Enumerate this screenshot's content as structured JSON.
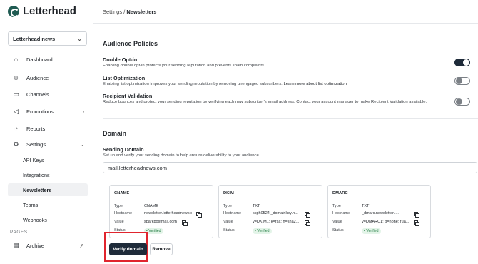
{
  "brand": {
    "name": "Letterhead",
    "color": "#1f5b52"
  },
  "publication_select": {
    "value": "Letterhead news"
  },
  "breadcrumb": {
    "parent": "Settings",
    "separator": " / ",
    "current": "Newsletters"
  },
  "sidebar": {
    "items": [
      {
        "label": "Dashboard",
        "icon": "home-icon"
      },
      {
        "label": "Audience",
        "icon": "users-icon"
      },
      {
        "label": "Channels",
        "icon": "monitor-icon"
      },
      {
        "label": "Promotions",
        "icon": "megaphone-icon"
      },
      {
        "label": "Reports",
        "icon": "chart-icon"
      },
      {
        "label": "Settings",
        "icon": "gear-icon"
      }
    ],
    "settings_sub": [
      "API Keys",
      "Integrations",
      "Newsletters",
      "Teams",
      "Webhooks"
    ],
    "pages_label": "PAGES",
    "archive": {
      "label": "Archive",
      "icon": "archive-icon"
    }
  },
  "audience_policies": {
    "heading": "Audience Policies",
    "policies": [
      {
        "title": "Double Opt-in",
        "desc": "Enabling double opt-in protects your sending reputation and prevents spam complaints.",
        "enabled": true
      },
      {
        "title": "List Optimization",
        "desc": "Enabling list optimization improves your sending reputation by removing unengaged subscribers.",
        "link": "Learn more about list optimization.",
        "enabled": false
      },
      {
        "title": "Recipient Validation",
        "desc": "Reduce bounces and protect your sending reputation by verifying each new subscriber's email address. Contact your account manager to make Recipient Validation available.",
        "enabled": false
      }
    ]
  },
  "domain": {
    "heading": "Domain",
    "sending_title": "Sending Domain",
    "sending_desc": "Set up and verify your sending domain to help ensure deliverability to your audience.",
    "value": "mail.letterheadnews.com",
    "labels": {
      "type": "Type",
      "hostname": "Hostname",
      "value": "Value",
      "status": "Status"
    },
    "records": [
      {
        "title": "CNAME",
        "type": "CNAME",
        "hostname": "newsletter.letterheadnews.com",
        "value": "sparkpostmail.com",
        "status": "Verified"
      },
      {
        "title": "DKIM",
        "type": "TXT",
        "hostname": "scph0524._domainkey.n...",
        "value": "v=DKIM1; k=rsa; h=sha2...",
        "status": "Verified"
      },
      {
        "title": "DMARC",
        "type": "TXT",
        "hostname": "_dmarc.newsletter.l...",
        "value": "v=DMARC1; p=none; rua...",
        "status": "Verified"
      }
    ],
    "verify_label": "Verify domain",
    "remove_label": "Remove"
  }
}
